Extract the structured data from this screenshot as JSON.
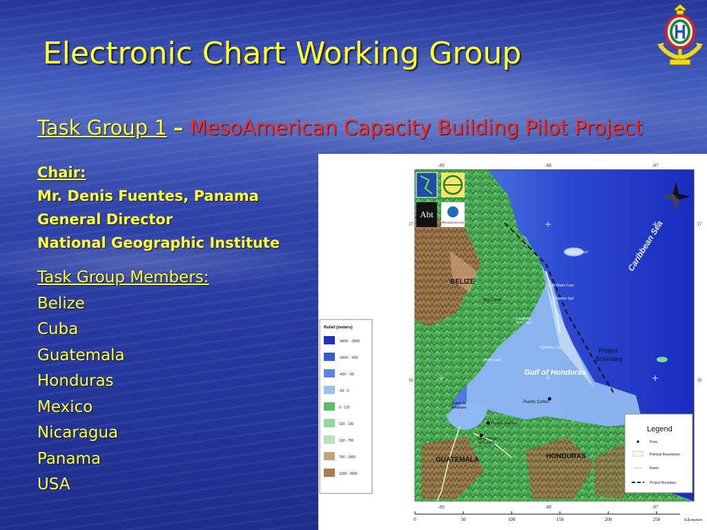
{
  "slide": {
    "title": "Electronic Chart Working Group",
    "subtitle_group": "Task Group 1",
    "subtitle_dash": "–",
    "subtitle_project": "MesoAmerican Capacity Building Pilot Project"
  },
  "chair": {
    "label": "Chair:",
    "lines": [
      "Mr. Denis Fuentes, Panama",
      "General Director",
      "National Geographic Institute"
    ]
  },
  "members": {
    "label": "Task Group Members:",
    "items": [
      "Belize",
      "Cuba",
      "Guatemala",
      "Honduras",
      "Mexico",
      "Nicaragua",
      "Panama",
      "USA"
    ]
  },
  "map": {
    "top_ticks": [
      "-89",
      "-88",
      "-87"
    ],
    "bottom_ticks": [
      "-89",
      "-88",
      "-87"
    ],
    "left_ticks": [
      "17",
      "16"
    ],
    "right_ticks": [
      "17",
      "16"
    ],
    "scale_values": [
      "0",
      "50",
      "100",
      "150",
      "200",
      "250"
    ],
    "scale_unit": "Kilometers",
    "labels": {
      "belize": "BELIZE",
      "guatemala": "GUATEMALA",
      "honduras": "HONDURAS",
      "caribbean_sea": "Caribbean Sea",
      "gulf_of_honduras": "Gulf of Honduras",
      "project_boundary": [
        "Project",
        "Boundary"
      ],
      "big_creek": "Big Creek",
      "puerto_cortes": "Puerto Cortes",
      "puerto_barrios": "Puerto Barrios",
      "santo_tomas": [
        "Santo Tomas",
        "de Castilla"
      ],
      "bahia_amatique": [
        "Bahia de",
        "Amatique"
      ],
      "sapodilla_cays": "Sapodilla Cays",
      "south_water_cays": "South Water Caye",
      "gladden_spit": "Gladden Spit",
      "laughing_bird": [
        "Laughing",
        "Bird Caye"
      ],
      "snake_cays": "Snake Cays",
      "glovers_reef": "Glover's Reef"
    },
    "relief_legend": {
      "title": "Relief (meters)",
      "entries": [
        {
          "label": "-4000 - -3000",
          "color": "#1e2fc8"
        },
        {
          "label": "-3000 - -400",
          "color": "#3a5ad8"
        },
        {
          "label": "-400 - -90",
          "color": "#5b84e6"
        },
        {
          "label": "-90 - 0",
          "color": "#9cc0f0"
        },
        {
          "label": "0 - 120",
          "color": "#54c060"
        },
        {
          "label": "120 - 130",
          "color": "#8fd89a"
        },
        {
          "label": "130 - 750",
          "color": "#b8e2b8"
        },
        {
          "label": "750 - 1000",
          "color": "#c4a27c"
        },
        {
          "label": "1000 - 2600",
          "color": "#b07850"
        }
      ]
    },
    "legend": {
      "title": "Legend",
      "items": [
        {
          "symbol": "dot",
          "label": "Ports"
        },
        {
          "symbol": "box",
          "label": "Political Boundaries"
        },
        {
          "symbol": "line",
          "label": "Reefs"
        },
        {
          "symbol": "dash",
          "label": "Project Boundary"
        }
      ]
    },
    "logos": {
      "abt": "Abt",
      "small_text": "Mesoamerican"
    }
  },
  "colors": {
    "title": "#ffff33",
    "project": "#ff2a1a"
  },
  "icons": {
    "logo": "iho-crest-icon"
  }
}
